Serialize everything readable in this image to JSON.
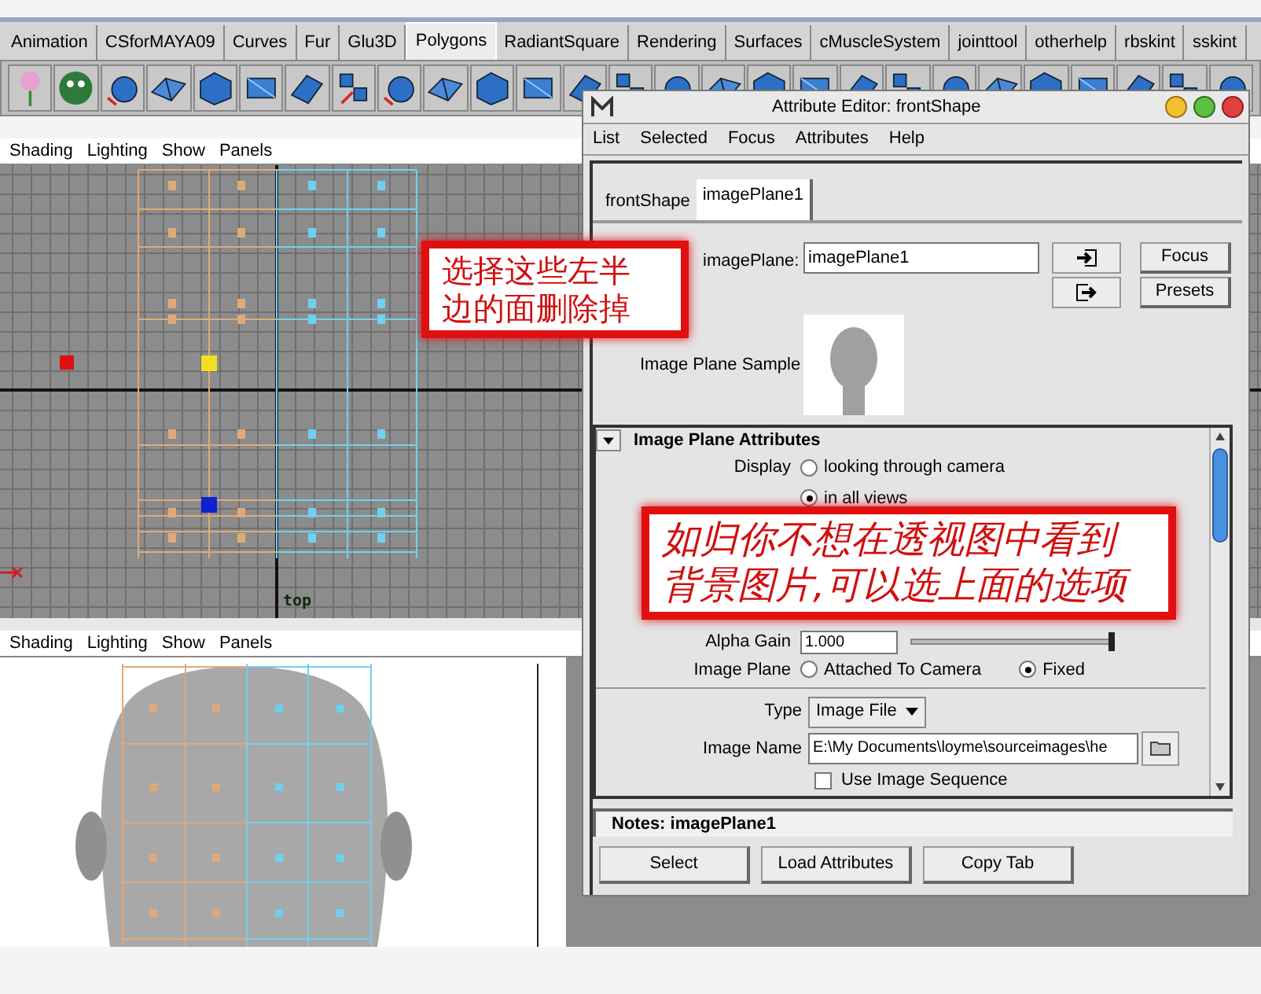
{
  "shelf_tabs": [
    {
      "label": "Animation",
      "selected": false
    },
    {
      "label": "CSforMAYA09",
      "selected": false
    },
    {
      "label": "Curves",
      "selected": false
    },
    {
      "label": "Fur",
      "selected": false
    },
    {
      "label": "Glu3D",
      "selected": false
    },
    {
      "label": "Polygons",
      "selected": true
    },
    {
      "label": "RadiantSquare",
      "selected": false
    },
    {
      "label": "Rendering",
      "selected": false
    },
    {
      "label": "Surfaces",
      "selected": false
    },
    {
      "label": "cMuscleSystem",
      "selected": false
    },
    {
      "label": "jointtool",
      "selected": false
    },
    {
      "label": "otherhelp",
      "selected": false
    },
    {
      "label": "rbskint",
      "selected": false
    },
    {
      "label": "sskint",
      "selected": false
    }
  ],
  "viewports": [
    {
      "kind": "grid",
      "menu": [
        "Shading",
        "Lighting",
        "Show",
        "Panels"
      ],
      "camera_label": "top"
    },
    {
      "kind": "image",
      "menu": [
        "Shading",
        "Lighting",
        "Show",
        "Panels"
      ]
    }
  ],
  "attribute_editor": {
    "title": "Attribute Editor: frontShape",
    "menu": [
      "List",
      "Selected",
      "Focus",
      "Attributes",
      "Help"
    ],
    "tabs": [
      {
        "label": "frontShape",
        "selected": false
      },
      {
        "label": "imagePlane1",
        "selected": true
      }
    ],
    "node_label": "imagePlane:",
    "node_value": "imagePlane1",
    "side_buttons": [
      "Focus",
      "Presets"
    ],
    "sample_label": "Image Plane Sample",
    "section": {
      "title": "Image Plane Attributes",
      "expanded": true
    },
    "display": {
      "label": "Display",
      "options": [
        {
          "label": "looking through camera",
          "selected": false
        },
        {
          "label": "in all views",
          "selected": true
        }
      ]
    },
    "alpha_gain": {
      "label": "Alpha Gain",
      "value": "1.000",
      "level": 1
    },
    "image_plane": {
      "label": "Image Plane",
      "options": [
        {
          "label": "Attached To Camera",
          "selected": false
        },
        {
          "label": "Fixed",
          "selected": true
        }
      ]
    },
    "type": {
      "label": "Type",
      "value": "Image File"
    },
    "image_name": {
      "label": "Image Name",
      "value": "E:\\My Documents\\loyme\\sourceimages\\he"
    },
    "use_image_sequence": {
      "label": "Use Image Sequence",
      "checked": false
    },
    "notes": "Notes: imagePlane1",
    "bottom_buttons": [
      "Select",
      "Load Attributes",
      "Copy Tab"
    ]
  },
  "callouts": [
    {
      "lines": [
        "选择这些左半",
        "边的面删除掉"
      ]
    },
    {
      "lines": [
        "如归你不想在透视图中看到",
        "背景图片,可以选上面的选项"
      ]
    }
  ]
}
